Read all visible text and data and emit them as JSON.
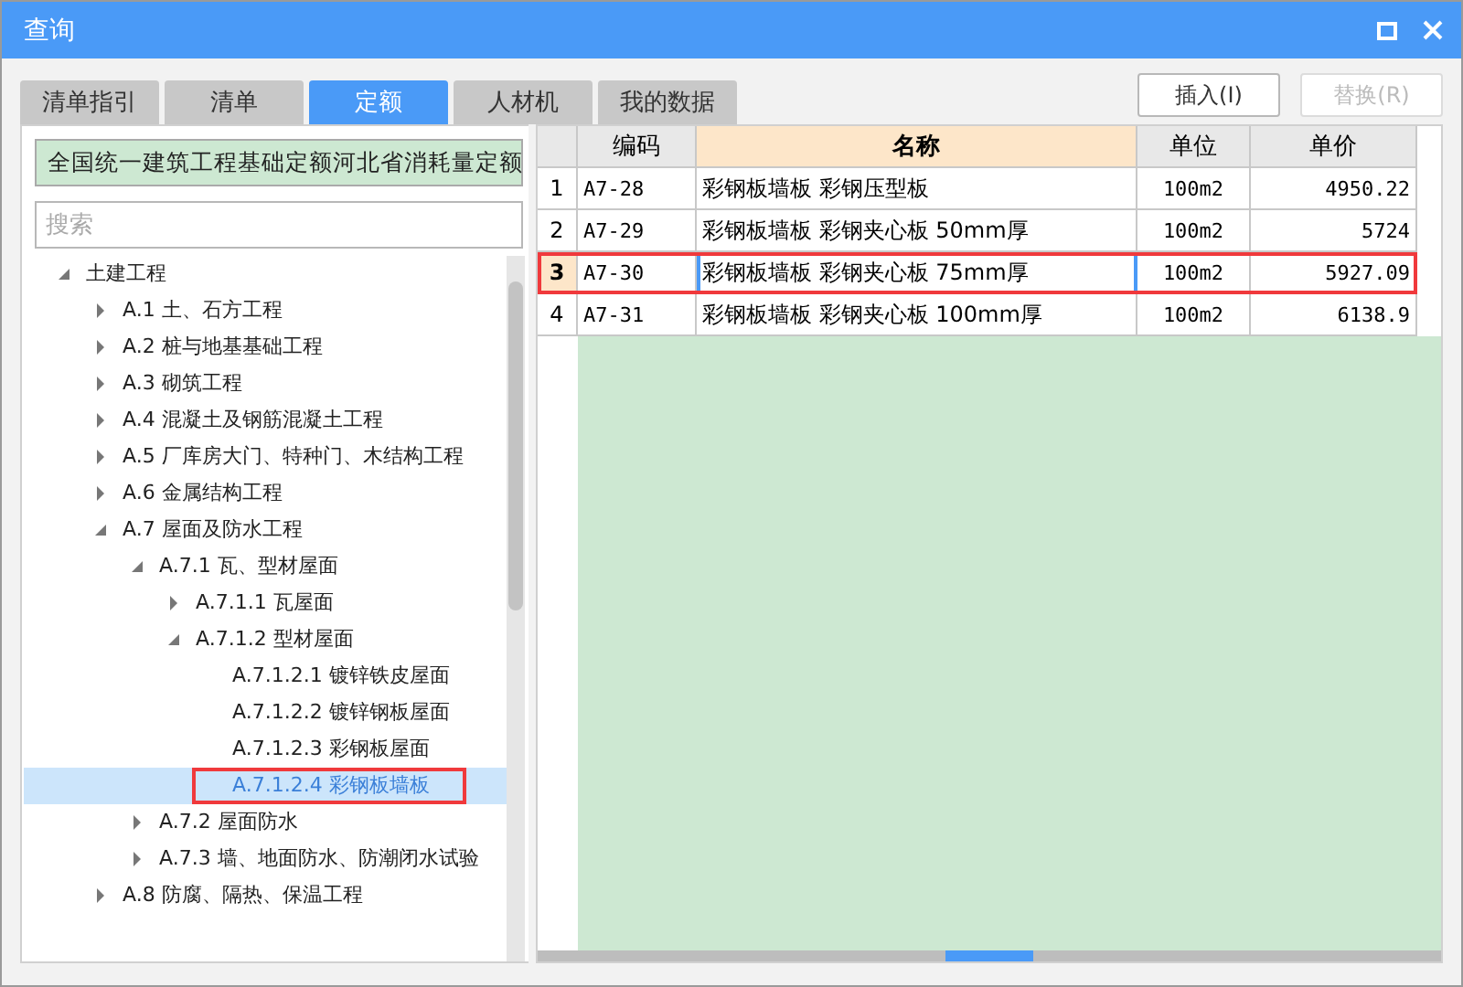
{
  "window": {
    "title": "查询"
  },
  "tabs": [
    {
      "label": "清单指引",
      "selected": false
    },
    {
      "label": "清单",
      "selected": false
    },
    {
      "label": "定额",
      "selected": true
    },
    {
      "label": "人材机",
      "selected": false
    },
    {
      "label": "我的数据",
      "selected": false
    }
  ],
  "buttons": [
    {
      "label": "插入(I)",
      "disabled": false
    },
    {
      "label": "替换(R)",
      "disabled": true
    }
  ],
  "library_select": {
    "value": "全国统一建筑工程基础定额河北省消耗量定额"
  },
  "search": {
    "placeholder": "搜索"
  },
  "tree": [
    {
      "label": "土建工程",
      "expanded": true,
      "selected": false,
      "children": [
        {
          "label": "A.1 土、石方工程",
          "expanded": false,
          "selected": false
        },
        {
          "label": "A.2 桩与地基基础工程",
          "expanded": false,
          "selected": false
        },
        {
          "label": "A.3 砌筑工程",
          "expanded": false,
          "selected": false
        },
        {
          "label": "A.4 混凝土及钢筋混凝土工程",
          "expanded": false,
          "selected": false
        },
        {
          "label": "A.5 厂库房大门、特种门、木结构工程",
          "expanded": false,
          "selected": false
        },
        {
          "label": "A.6 金属结构工程",
          "expanded": false,
          "selected": false
        },
        {
          "label": "A.7 屋面及防水工程",
          "expanded": true,
          "selected": false,
          "children": [
            {
              "label": "A.7.1 瓦、型材屋面",
              "expanded": true,
              "selected": false,
              "children": [
                {
                  "label": "A.7.1.1 瓦屋面",
                  "expanded": false,
                  "selected": false
                },
                {
                  "label": "A.7.1.2 型材屋面",
                  "expanded": true,
                  "selected": false,
                  "children": [
                    {
                      "label": "A.7.1.2.1 镀锌铁皮屋面",
                      "selected": false
                    },
                    {
                      "label": "A.7.1.2.2 镀锌钢板屋面",
                      "selected": false
                    },
                    {
                      "label": "A.7.1.2.3 彩钢板屋面",
                      "selected": false
                    },
                    {
                      "label": "A.7.1.2.4 彩钢板墙板",
                      "selected": true,
                      "highlighted": true
                    }
                  ]
                }
              ]
            },
            {
              "label": "A.7.2 屋面防水",
              "expanded": false,
              "selected": false
            },
            {
              "label": "A.7.3 墙、地面防水、防潮闭水试验",
              "expanded": false,
              "selected": false
            }
          ]
        },
        {
          "label": "A.8 防腐、隔热、保温工程",
          "expanded": false,
          "selected": false
        }
      ]
    }
  ],
  "table": {
    "columns": [
      "编码",
      "名称",
      "单位",
      "单价"
    ],
    "rows": [
      {
        "number": "1",
        "code": "A7-28",
        "name": "彩钢板墙板 彩钢压型板",
        "unit": "100m2",
        "price": "4950.22",
        "selected": false
      },
      {
        "number": "2",
        "code": "A7-29",
        "name": "彩钢板墙板 彩钢夹心板 50mm厚",
        "unit": "100m2",
        "price": "5724",
        "selected": false
      },
      {
        "number": "3",
        "code": "A7-30",
        "name": "彩钢板墙板 彩钢夹心板 75mm厚",
        "unit": "100m2",
        "price": "5927.09",
        "selected": true,
        "highlighted": true
      },
      {
        "number": "4",
        "code": "A7-31",
        "name": "彩钢板墙板 彩钢夹心板 100mm厚",
        "unit": "100m2",
        "price": "6138.9",
        "selected": false
      }
    ]
  }
}
